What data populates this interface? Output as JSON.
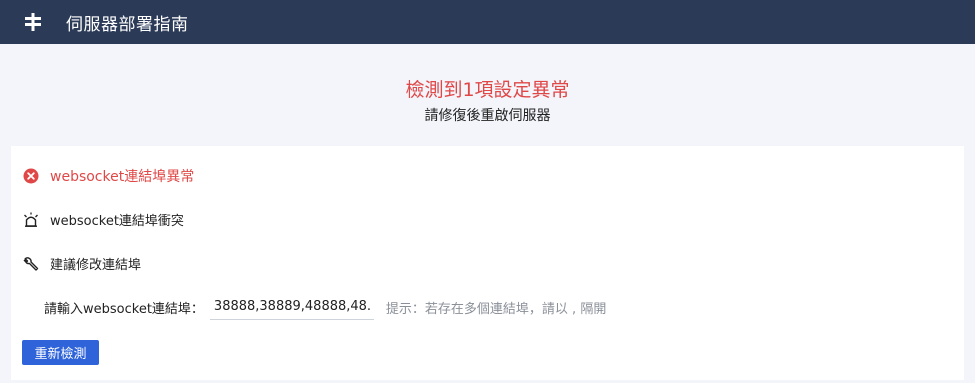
{
  "header": {
    "app_title": "伺服器部署指南",
    "logo_icon": "server-logo-icon"
  },
  "summary": {
    "title": "檢測到1項設定異常",
    "subtitle": "請修復後重啟伺服器"
  },
  "issue": {
    "error_title": "websocket連結埠異常",
    "error_icon": "error-circle-icon",
    "detail": "websocket連結埠衝突",
    "detail_icon": "alarm-icon",
    "suggestion": "建議修改連結埠",
    "suggestion_icon": "wrench-icon",
    "input_label": "請輸入websocket連結埠：",
    "input_value": "38888,38889,48888,48...",
    "hint": "提示：若存在多個連結埠，請以 , 隔開"
  },
  "actions": {
    "recheck_label": "重新檢測"
  },
  "colors": {
    "header_bg": "#2b3a57",
    "error": "#e04848",
    "primary": "#2e63d9",
    "page_bg": "#f3f5fa"
  }
}
